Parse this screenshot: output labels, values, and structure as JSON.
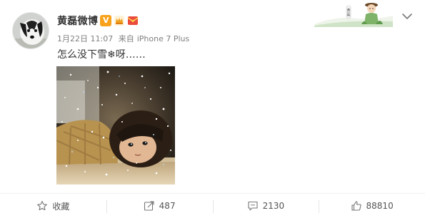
{
  "post": {
    "author": "黄磊微博",
    "badges": [
      "vip-v-badge",
      "crown-badge",
      "heart-envelope-badge"
    ],
    "date": "1月22日 11:07",
    "source_prefix": "来自",
    "source": "iPhone 7 Plus",
    "text": "怎么没下雪❄呀……",
    "image_description_icon": "photo-child-snow"
  },
  "actions": [
    {
      "icon": "star-icon",
      "label": "收藏"
    },
    {
      "icon": "share-icon",
      "label": "487"
    },
    {
      "icon": "comment-icon",
      "label": "2130"
    },
    {
      "icon": "thumbs-up-icon",
      "label": "88810"
    }
  ],
  "colors": {
    "accent": "#f8a21b",
    "text": "#333333",
    "meta": "#808080"
  }
}
